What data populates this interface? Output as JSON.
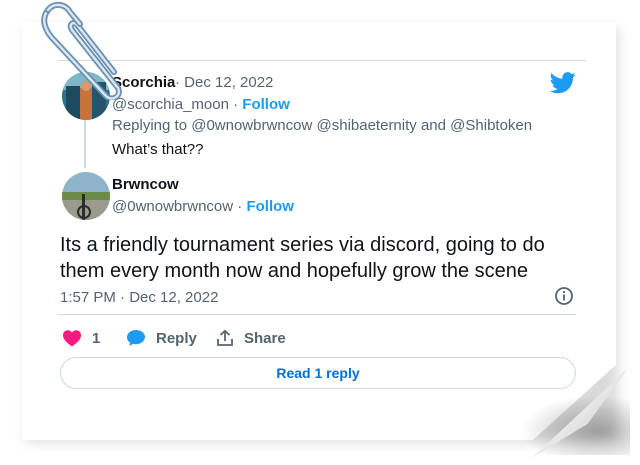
{
  "original_tweet": {
    "author_name": "Scorchia",
    "date": "· Dec 12, 2022",
    "handle": "@scorchia_moon",
    "follow_label": "Follow",
    "replying_prefix": "Replying to",
    "mentions": [
      "@0wnowbrwncow",
      "@shibaeternity",
      "@Shibtoken"
    ],
    "mention_joiner": "and",
    "text": "What’s that??"
  },
  "reply_tweet": {
    "author_name": "Brwncow",
    "handle": "@0wnowbrwncow",
    "follow_label": "Follow",
    "text": "Its a friendly tournament series via discord, going to do them every month now and hopefully grow the scene",
    "timestamp": "1:57 PM · Dec 12, 2022"
  },
  "actions": {
    "like_count": "1",
    "reply_label": "Reply",
    "share_label": "Share"
  },
  "read_replies_label": "Read 1 reply",
  "colors": {
    "accent": "#1d9bf0",
    "like": "#f91880",
    "secondary_text": "#536471",
    "divider": "#cfd9de"
  },
  "icons": {
    "brand": "twitter-bird-icon",
    "like": "heart-icon",
    "reply": "speech-bubble-icon",
    "share": "share-upload-icon",
    "info": "info-icon",
    "decoration": "paperclip-icon"
  }
}
